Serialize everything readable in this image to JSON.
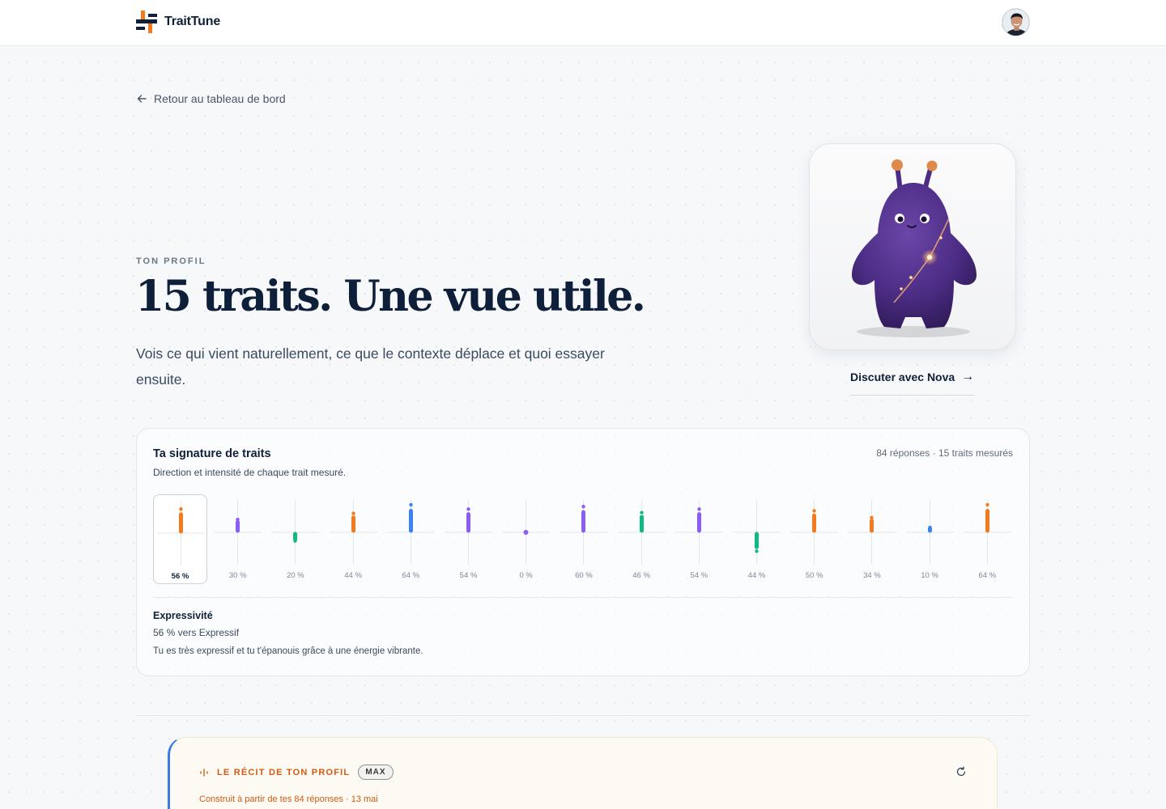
{
  "app": {
    "name": "TraitTune",
    "colors": {
      "accent_orange": "#f47b1d",
      "navy": "#0f2139",
      "purple": "#8b5cf6",
      "blue": "#3b82f6",
      "green": "#10b981"
    }
  },
  "header": {
    "avatar_icon": "user-avatar"
  },
  "nav": {
    "back_label": "Retour au tableau de bord"
  },
  "hero": {
    "eyebrow": "TON PROFIL",
    "title": "15 traits. Une vue utile.",
    "subtitle": "Vois ce qui vient naturellement, ce que le contexte déplace et quoi essayer ensuite.",
    "chat_label": "Discuter avec Nova",
    "chat_arrow": "→"
  },
  "signature": {
    "title": "Ta signature de traits",
    "subtitle": "Direction et intensité de chaque trait mesuré.",
    "meta": "84 réponses · 15 traits mesurés",
    "traits": [
      {
        "pct": "56 %",
        "value": 56,
        "dir": "up",
        "color": "#f47b1d"
      },
      {
        "pct": "30 %",
        "value": 30,
        "dir": "up",
        "color": "#8b5cf6"
      },
      {
        "pct": "20 %",
        "value": 20,
        "dir": "down",
        "color": "#10b981"
      },
      {
        "pct": "44 %",
        "value": 44,
        "dir": "up",
        "color": "#f47b1d"
      },
      {
        "pct": "64 %",
        "value": 64,
        "dir": "up",
        "color": "#3b82f6"
      },
      {
        "pct": "54 %",
        "value": 54,
        "dir": "up",
        "color": "#8b5cf6"
      },
      {
        "pct": "0 %",
        "value": 0,
        "dir": "none",
        "color": "#8b5cf6"
      },
      {
        "pct": "60 %",
        "value": 60,
        "dir": "up",
        "color": "#8b5cf6"
      },
      {
        "pct": "46 %",
        "value": 46,
        "dir": "up",
        "color": "#10b981"
      },
      {
        "pct": "54 %",
        "value": 54,
        "dir": "up",
        "color": "#8b5cf6"
      },
      {
        "pct": "44 %",
        "value": 44,
        "dir": "down",
        "color": "#10b981"
      },
      {
        "pct": "50 %",
        "value": 50,
        "dir": "up",
        "color": "#f47b1d"
      },
      {
        "pct": "34 %",
        "value": 34,
        "dir": "up",
        "color": "#f47b1d"
      },
      {
        "pct": "10 %",
        "value": 10,
        "dir": "up",
        "color": "#3b82f6"
      },
      {
        "pct": "64 %",
        "value": 64,
        "dir": "up",
        "color": "#f47b1d"
      }
    ],
    "selected_index": 0,
    "selected": {
      "name": "Expressivité",
      "pct_text": "56 % vers Expressif",
      "description": "Tu es très expressif et tu t'épanouis grâce à une énergie vibrante."
    }
  },
  "story": {
    "label": "LE RÉCIT DE TON PROFIL",
    "badge": "MAX",
    "meta": "Construit à partir de tes 84 réponses · 13 mai"
  }
}
